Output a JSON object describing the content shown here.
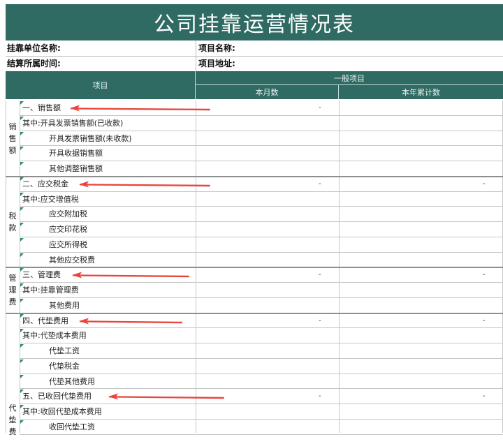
{
  "title": "公司挂靠运营情况表",
  "info": {
    "unit_label": "挂靠单位名称:",
    "project_name_label": "项目名称:",
    "period_label": "结算所属时间:",
    "project_address_label": "项目地址:"
  },
  "header": {
    "item": "项目",
    "general": "一般项目",
    "month": "本月数",
    "year": "本年累计数"
  },
  "groups": [
    {
      "label": "销售额",
      "chars": [
        "销",
        "售",
        "额"
      ]
    },
    {
      "label": "税款",
      "chars": [
        "税",
        "款"
      ]
    },
    {
      "label": "管理费",
      "chars": [
        "管",
        "理",
        "费"
      ]
    },
    {
      "label": "代垫",
      "chars": [
        "代",
        "垫",
        "费"
      ]
    }
  ],
  "rows": [
    {
      "item": "一、销售额",
      "month": "-",
      "year": ""
    },
    {
      "item": "其中:开具发票销售额(已收款)",
      "month": "",
      "year": ""
    },
    {
      "item": "开具发票销售额(未收款)",
      "month": "",
      "year": ""
    },
    {
      "item": "开具收据销售额",
      "month": "",
      "year": ""
    },
    {
      "item": "其他调整销售额",
      "month": "",
      "year": ""
    },
    {
      "item": "二、应交税金",
      "month": "-",
      "year": "-"
    },
    {
      "item": "其中:应交增值税",
      "month": "",
      "year": ""
    },
    {
      "item": "应交附加税",
      "month": "",
      "year": ""
    },
    {
      "item": "应交印花税",
      "month": "",
      "year": ""
    },
    {
      "item": "应交所得税",
      "month": "",
      "year": ""
    },
    {
      "item": "其他应交税费",
      "month": "",
      "year": ""
    },
    {
      "item": "三、管理费",
      "month": "-",
      "year": "-"
    },
    {
      "item": "其中:挂靠管理费",
      "month": "",
      "year": ""
    },
    {
      "item": "其他费用",
      "month": "",
      "year": ""
    },
    {
      "item": "四、代垫费用",
      "month": "-",
      "year": "-"
    },
    {
      "item": "其中:代垫成本费用",
      "month": "",
      "year": ""
    },
    {
      "item": "代垫工资",
      "month": "",
      "year": ""
    },
    {
      "item": "代垫税金",
      "month": "",
      "year": ""
    },
    {
      "item": "代垫其他费用",
      "month": "",
      "year": ""
    },
    {
      "item": "五、已收回代垫费用",
      "month": "-",
      "year": "-"
    },
    {
      "item": "其中:收回代垫成本费用",
      "month": "",
      "year": ""
    },
    {
      "item": "收回代垫工资",
      "month": "",
      "year": ""
    }
  ],
  "colors": {
    "header_bg": "#2f6b62",
    "arrow": "#e8453c",
    "cell_marker": "#2e8b57"
  }
}
